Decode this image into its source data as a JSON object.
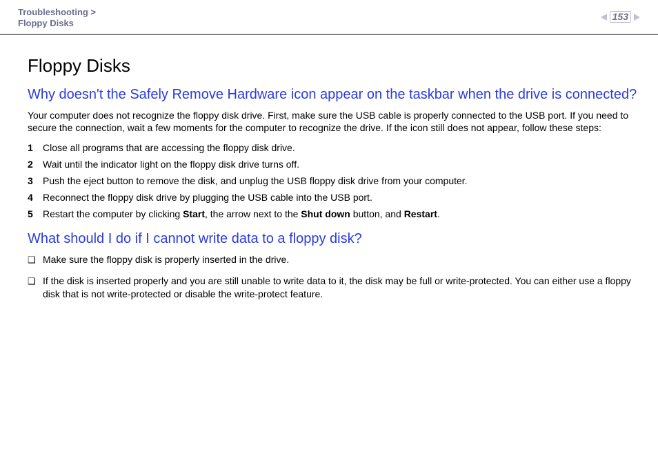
{
  "header": {
    "breadcrumb_line1": "Troubleshooting >",
    "breadcrumb_line2": "Floppy Disks",
    "page_number": "153"
  },
  "content": {
    "title": "Floppy Disks",
    "q1": {
      "heading": "Why doesn't the Safely Remove Hardware icon appear on the taskbar when the drive is connected?",
      "intro": "Your computer does not recognize the floppy disk drive. First, make sure the USB cable is properly connected to the USB port. If you need to secure the connection, wait a few moments for the computer to recognize the drive. If the icon still does not appear, follow these steps:",
      "steps": [
        {
          "n": "1",
          "text": "Close all programs that are accessing the floppy disk drive."
        },
        {
          "n": "2",
          "text": "Wait until the indicator light on the floppy disk drive turns off."
        },
        {
          "n": "3",
          "text": "Push the eject button to remove the disk, and unplug the USB floppy disk drive from your computer."
        },
        {
          "n": "4",
          "text": "Reconnect the floppy disk drive by plugging the USB cable into the USB port."
        },
        {
          "n": "5",
          "pre": "Restart the computer by clicking ",
          "b1": "Start",
          "mid1": ", the arrow next to the ",
          "b2": "Shut down",
          "mid2": " button, and ",
          "b3": "Restart",
          "post": "."
        }
      ]
    },
    "q2": {
      "heading": "What should I do if I cannot write data to a floppy disk?",
      "bullets": [
        "Make sure the floppy disk is properly inserted in the drive.",
        "If the disk is inserted properly and you are still unable to write data to it, the disk may be full or write-protected. You can either use a floppy disk that is not write-protected or disable the write-protect feature."
      ]
    }
  }
}
